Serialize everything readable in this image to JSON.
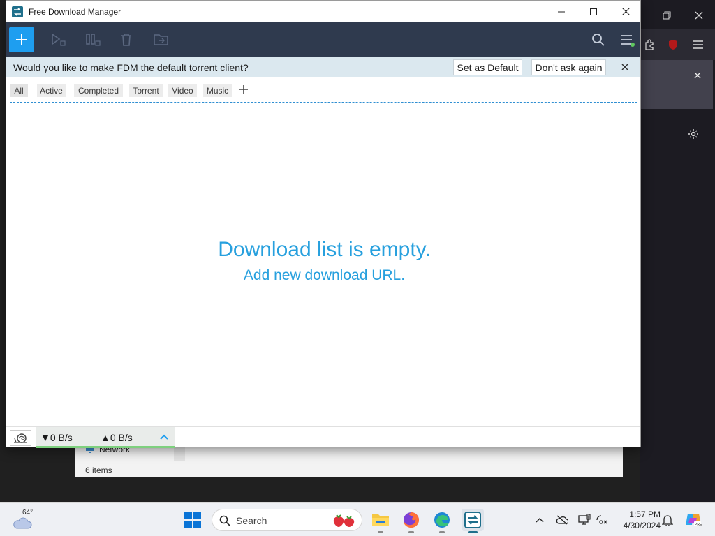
{
  "window": {
    "title": "Free Download Manager"
  },
  "toolbar": {
    "icons": [
      "add-download",
      "resume",
      "pause",
      "delete",
      "move-folder",
      "search",
      "menu"
    ]
  },
  "notification": {
    "message": "Would you like to make FDM the default torrent client?",
    "set_default_label": "Set as Default",
    "dont_ask_label": "Don't ask again"
  },
  "tabs": {
    "items": [
      {
        "label": "All"
      },
      {
        "label": "Active"
      },
      {
        "label": "Completed"
      },
      {
        "label": "Torrent"
      },
      {
        "label": "Video"
      },
      {
        "label": "Music"
      }
    ]
  },
  "empty_state": {
    "title": "Download list is empty.",
    "subtitle": "Add new download URL."
  },
  "status_bar": {
    "download_speed": "0 B/s",
    "upload_speed": "0 B/s",
    "down_arrow": "▼",
    "up_arrow": "▲"
  },
  "background_explorer": {
    "network_label": "Network",
    "item_count": "6 items"
  },
  "taskbar": {
    "weather_temp": "64°",
    "search_label": "Search",
    "time": "1:57 PM",
    "date": "4/30/2024"
  },
  "colors": {
    "accent": "#1e9ef0",
    "toolbar_bg": "#2f3a4e",
    "notif_bg": "#dbe8ef",
    "empty_text": "#27a0de"
  }
}
